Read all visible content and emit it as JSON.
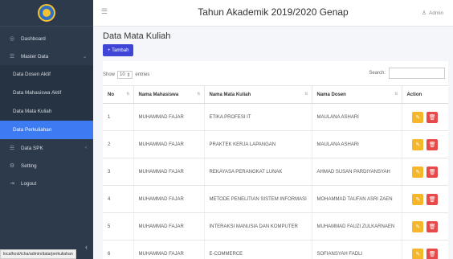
{
  "header": {
    "title": "Tahun Akademik 2019/2020 Genap",
    "user": "Admin"
  },
  "sidebar": {
    "items": [
      {
        "label": "Dashboard",
        "icon": "dashboard-icon"
      },
      {
        "label": "Master Data",
        "icon": "list-icon"
      },
      {
        "label": "Data SPK",
        "icon": "list-icon"
      },
      {
        "label": "Setting",
        "icon": "gear-icon"
      },
      {
        "label": "Logout",
        "icon": "logout-icon"
      }
    ],
    "submenu": [
      {
        "label": "Data Dosen Aktif"
      },
      {
        "label": "Data Mahasiswa Aktif"
      },
      {
        "label": "Data Mata Kuliah"
      },
      {
        "label": "Data Perkuliahan",
        "active": true
      }
    ],
    "status_url": "localhost/icha/admin/data/perkuliahan"
  },
  "page": {
    "title": "Data Mata Kuliah",
    "add_label": "+ Tambah"
  },
  "table_controls": {
    "show_label": "Show",
    "entries_value": "10",
    "entries_label": "entries",
    "search_label": "Search:"
  },
  "table": {
    "headers": [
      "No",
      "Nama Mahasiswa",
      "Nama Mata Kuliah",
      "Nama Dosen",
      "Action"
    ],
    "rows": [
      [
        "1",
        "MUHAMMAD FAJAR",
        "ETIKA PROFESI IT",
        "MAULANA ASHARI"
      ],
      [
        "2",
        "MUHAMMAD FAJAR",
        "PRAKTEK KERJA LAPANGAN",
        "MAULANA ASHARI"
      ],
      [
        "3",
        "MUHAMMAD FAJAR",
        "REKAYASA PERANGKAT LUNAK",
        "AHMAD SUSAN PARDIYANSYAH"
      ],
      [
        "4",
        "MUHAMMAD FAJAR",
        "METODE PENELITIAN SISTEM INFORMASI",
        "MOHAMMAD TAUFAN ASRI ZAEN"
      ],
      [
        "5",
        "MUHAMMAD FAJAR",
        "INTERAKSI MANUSIA DAN KOMPUTER",
        "MUHAMMAD FAUZI ZULKARNAEN"
      ],
      [
        "6",
        "MUHAMMAD FAJAR",
        "E-COMMERCE",
        "SOFIANSYAH FADLI"
      ]
    ]
  },
  "colors": {
    "sidebar": "#2c3a4c",
    "active": "#3d7bf2",
    "add_button": "#3f46d7",
    "edit": "#f5b62a",
    "delete": "#e84a4a"
  }
}
